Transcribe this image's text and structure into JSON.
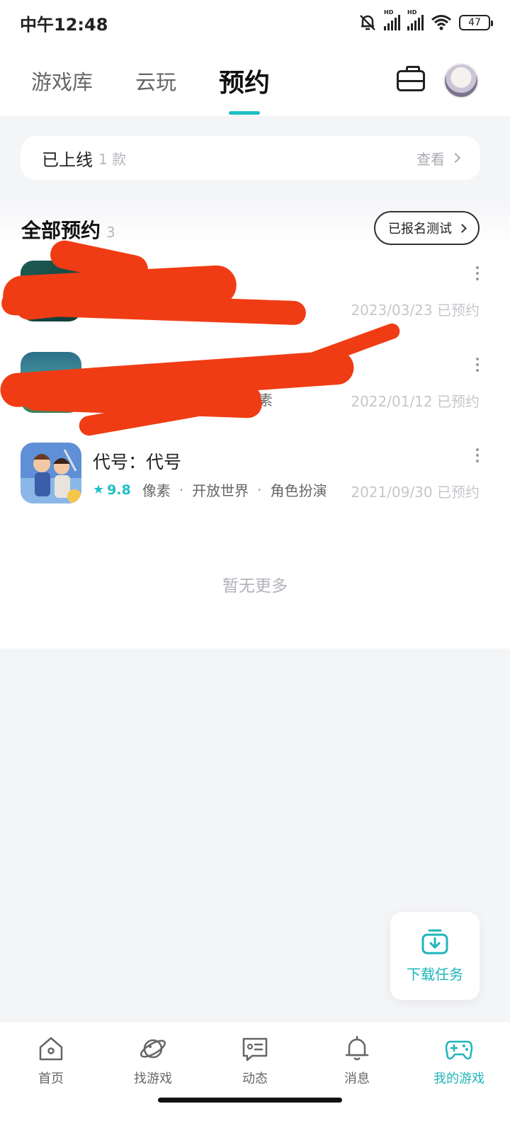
{
  "status_bar": {
    "time": "中午12:48",
    "battery": "47",
    "hd1": "HD",
    "hd2": "HD"
  },
  "header": {
    "tabs": [
      {
        "label": "游戏库",
        "active": false
      },
      {
        "label": "云玩",
        "active": false
      },
      {
        "label": "预约",
        "active": true
      }
    ],
    "toolbox_icon": "toolbox-icon",
    "avatar_icon": "avatar"
  },
  "online": {
    "title": "已上线",
    "count": "1 款",
    "view": "查看"
  },
  "reservations": {
    "title": "全部预约",
    "count": "3",
    "test_button": "已报名测试",
    "items": [
      {
        "name": "",
        "score": "",
        "tags": [],
        "date": "2023/03/23 已预约",
        "redacted": true
      },
      {
        "name": "",
        "score": "",
        "tags": [
          "像素"
        ],
        "date": "2022/01/12 已预约",
        "redacted": true
      },
      {
        "name": "代号：代号",
        "score": "9.8",
        "tags": [
          "像素",
          "开放世界",
          "角色扮演"
        ],
        "date": "2021/09/30 已预约",
        "redacted": false
      }
    ],
    "no_more": "暂无更多"
  },
  "download_fab": {
    "label": "下载任务"
  },
  "bottom_nav": [
    {
      "label": "首页",
      "icon": "home-icon",
      "active": false
    },
    {
      "label": "找游戏",
      "icon": "planet-icon",
      "active": false
    },
    {
      "label": "动态",
      "icon": "message-card-icon",
      "active": false
    },
    {
      "label": "消息",
      "icon": "bell-icon",
      "active": false
    },
    {
      "label": "我的游戏",
      "icon": "gamepad-icon",
      "active": true
    }
  ],
  "colors": {
    "accent": "#1fbfc5",
    "redaction": "#f03c14"
  }
}
